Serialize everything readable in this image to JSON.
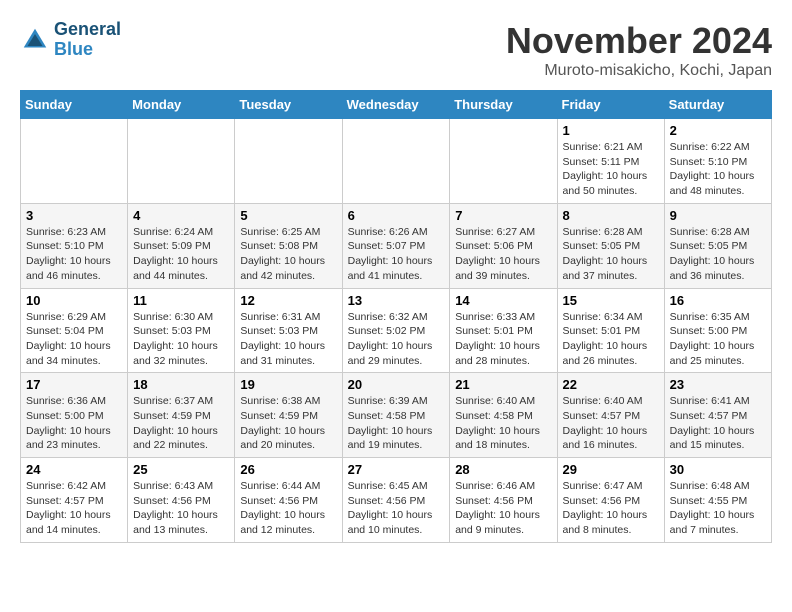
{
  "header": {
    "logo_line1": "General",
    "logo_line2": "Blue",
    "month": "November 2024",
    "location": "Muroto-misakicho, Kochi, Japan"
  },
  "days_of_week": [
    "Sunday",
    "Monday",
    "Tuesday",
    "Wednesday",
    "Thursday",
    "Friday",
    "Saturday"
  ],
  "weeks": [
    [
      {
        "day": "",
        "info": ""
      },
      {
        "day": "",
        "info": ""
      },
      {
        "day": "",
        "info": ""
      },
      {
        "day": "",
        "info": ""
      },
      {
        "day": "",
        "info": ""
      },
      {
        "day": "1",
        "info": "Sunrise: 6:21 AM\nSunset: 5:11 PM\nDaylight: 10 hours\nand 50 minutes."
      },
      {
        "day": "2",
        "info": "Sunrise: 6:22 AM\nSunset: 5:10 PM\nDaylight: 10 hours\nand 48 minutes."
      }
    ],
    [
      {
        "day": "3",
        "info": "Sunrise: 6:23 AM\nSunset: 5:10 PM\nDaylight: 10 hours\nand 46 minutes."
      },
      {
        "day": "4",
        "info": "Sunrise: 6:24 AM\nSunset: 5:09 PM\nDaylight: 10 hours\nand 44 minutes."
      },
      {
        "day": "5",
        "info": "Sunrise: 6:25 AM\nSunset: 5:08 PM\nDaylight: 10 hours\nand 42 minutes."
      },
      {
        "day": "6",
        "info": "Sunrise: 6:26 AM\nSunset: 5:07 PM\nDaylight: 10 hours\nand 41 minutes."
      },
      {
        "day": "7",
        "info": "Sunrise: 6:27 AM\nSunset: 5:06 PM\nDaylight: 10 hours\nand 39 minutes."
      },
      {
        "day": "8",
        "info": "Sunrise: 6:28 AM\nSunset: 5:05 PM\nDaylight: 10 hours\nand 37 minutes."
      },
      {
        "day": "9",
        "info": "Sunrise: 6:28 AM\nSunset: 5:05 PM\nDaylight: 10 hours\nand 36 minutes."
      }
    ],
    [
      {
        "day": "10",
        "info": "Sunrise: 6:29 AM\nSunset: 5:04 PM\nDaylight: 10 hours\nand 34 minutes."
      },
      {
        "day": "11",
        "info": "Sunrise: 6:30 AM\nSunset: 5:03 PM\nDaylight: 10 hours\nand 32 minutes."
      },
      {
        "day": "12",
        "info": "Sunrise: 6:31 AM\nSunset: 5:03 PM\nDaylight: 10 hours\nand 31 minutes."
      },
      {
        "day": "13",
        "info": "Sunrise: 6:32 AM\nSunset: 5:02 PM\nDaylight: 10 hours\nand 29 minutes."
      },
      {
        "day": "14",
        "info": "Sunrise: 6:33 AM\nSunset: 5:01 PM\nDaylight: 10 hours\nand 28 minutes."
      },
      {
        "day": "15",
        "info": "Sunrise: 6:34 AM\nSunset: 5:01 PM\nDaylight: 10 hours\nand 26 minutes."
      },
      {
        "day": "16",
        "info": "Sunrise: 6:35 AM\nSunset: 5:00 PM\nDaylight: 10 hours\nand 25 minutes."
      }
    ],
    [
      {
        "day": "17",
        "info": "Sunrise: 6:36 AM\nSunset: 5:00 PM\nDaylight: 10 hours\nand 23 minutes."
      },
      {
        "day": "18",
        "info": "Sunrise: 6:37 AM\nSunset: 4:59 PM\nDaylight: 10 hours\nand 22 minutes."
      },
      {
        "day": "19",
        "info": "Sunrise: 6:38 AM\nSunset: 4:59 PM\nDaylight: 10 hours\nand 20 minutes."
      },
      {
        "day": "20",
        "info": "Sunrise: 6:39 AM\nSunset: 4:58 PM\nDaylight: 10 hours\nand 19 minutes."
      },
      {
        "day": "21",
        "info": "Sunrise: 6:40 AM\nSunset: 4:58 PM\nDaylight: 10 hours\nand 18 minutes."
      },
      {
        "day": "22",
        "info": "Sunrise: 6:40 AM\nSunset: 4:57 PM\nDaylight: 10 hours\nand 16 minutes."
      },
      {
        "day": "23",
        "info": "Sunrise: 6:41 AM\nSunset: 4:57 PM\nDaylight: 10 hours\nand 15 minutes."
      }
    ],
    [
      {
        "day": "24",
        "info": "Sunrise: 6:42 AM\nSunset: 4:57 PM\nDaylight: 10 hours\nand 14 minutes."
      },
      {
        "day": "25",
        "info": "Sunrise: 6:43 AM\nSunset: 4:56 PM\nDaylight: 10 hours\nand 13 minutes."
      },
      {
        "day": "26",
        "info": "Sunrise: 6:44 AM\nSunset: 4:56 PM\nDaylight: 10 hours\nand 12 minutes."
      },
      {
        "day": "27",
        "info": "Sunrise: 6:45 AM\nSunset: 4:56 PM\nDaylight: 10 hours\nand 10 minutes."
      },
      {
        "day": "28",
        "info": "Sunrise: 6:46 AM\nSunset: 4:56 PM\nDaylight: 10 hours\nand 9 minutes."
      },
      {
        "day": "29",
        "info": "Sunrise: 6:47 AM\nSunset: 4:56 PM\nDaylight: 10 hours\nand 8 minutes."
      },
      {
        "day": "30",
        "info": "Sunrise: 6:48 AM\nSunset: 4:55 PM\nDaylight: 10 hours\nand 7 minutes."
      }
    ]
  ]
}
